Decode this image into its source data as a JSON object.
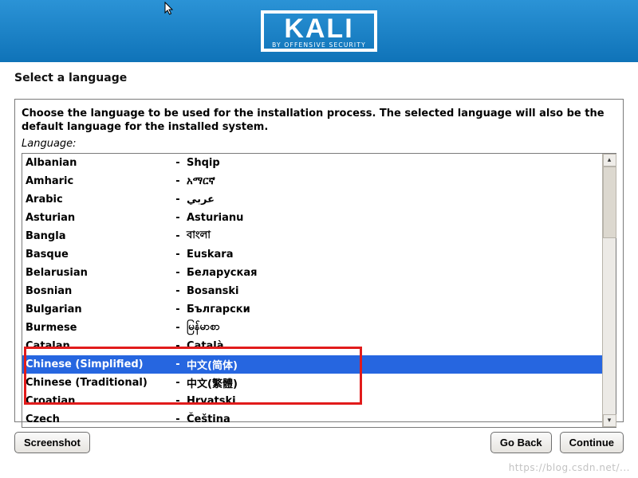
{
  "logo": {
    "main": "KALI",
    "sub": "BY OFFENSIVE SECURITY"
  },
  "title": "Select a language",
  "instruction": "Choose the language to be used for the installation process. The selected language will also be the default language for the installed system.",
  "field_label": "Language:",
  "selected_index": 10,
  "languages": [
    {
      "name": "Albanian",
      "native": "Shqip"
    },
    {
      "name": "Amharic",
      "native": "አማርኛ"
    },
    {
      "name": "Arabic",
      "native": "عربي"
    },
    {
      "name": "Asturian",
      "native": "Asturianu"
    },
    {
      "name": "Bangla",
      "native": "বাংলা"
    },
    {
      "name": "Basque",
      "native": "Euskara"
    },
    {
      "name": "Belarusian",
      "native": "Беларуская"
    },
    {
      "name": "Bosnian",
      "native": "Bosanski"
    },
    {
      "name": "Bulgarian",
      "native": "Български"
    },
    {
      "name": "Burmese",
      "native": "မြန်မာစာ"
    },
    {
      "name": "Catalan",
      "native": "Català"
    },
    {
      "name": "Chinese (Simplified)",
      "native": "中文(简体)"
    },
    {
      "name": "Chinese (Traditional)",
      "native": "中文(繁體)"
    },
    {
      "name": "Croatian",
      "native": "Hrvatski"
    },
    {
      "name": "Czech",
      "native": "Čeština"
    }
  ],
  "buttons": {
    "screenshot": "Screenshot",
    "go_back": "Go Back",
    "continue": "Continue"
  },
  "watermark": "https://blog.csdn.net/..."
}
